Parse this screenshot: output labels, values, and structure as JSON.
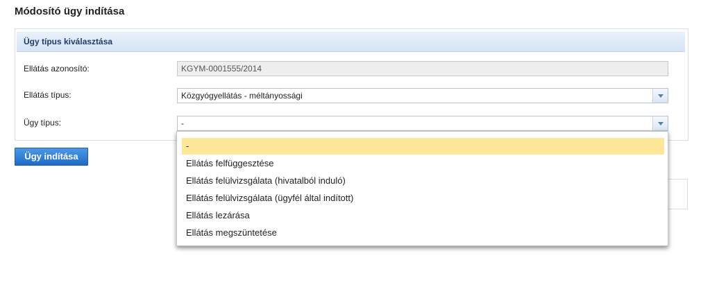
{
  "page_title": "Módosító ügy indítása",
  "panel": {
    "header": "Ügy típus kiválasztása",
    "rows": [
      {
        "label": "Ellátás azonosító:",
        "value": "KGYM-0001555/2014"
      },
      {
        "label": "Ellátás típus:",
        "value": "Közgyógyellátás - méltányossági"
      },
      {
        "label": "Ügy típus:",
        "value": "-"
      }
    ]
  },
  "start_button": "Ügy indítása",
  "dropdown": {
    "items": [
      "-",
      "Ellátás felfüggesztése",
      "Ellátás felülvizsgálata (hivatalból induló)",
      "Ellátás felülvizsgálata (ügyfél által indított)",
      "Ellátás lezárása",
      "Ellátás megszüntetése"
    ],
    "selected_index": 0
  },
  "colors": {
    "accent": "#1f6cc6",
    "selected_item": "#fde89a",
    "header_text": "#1f3d6b"
  },
  "icons": {
    "combo_trigger": "chevron-down-icon"
  }
}
